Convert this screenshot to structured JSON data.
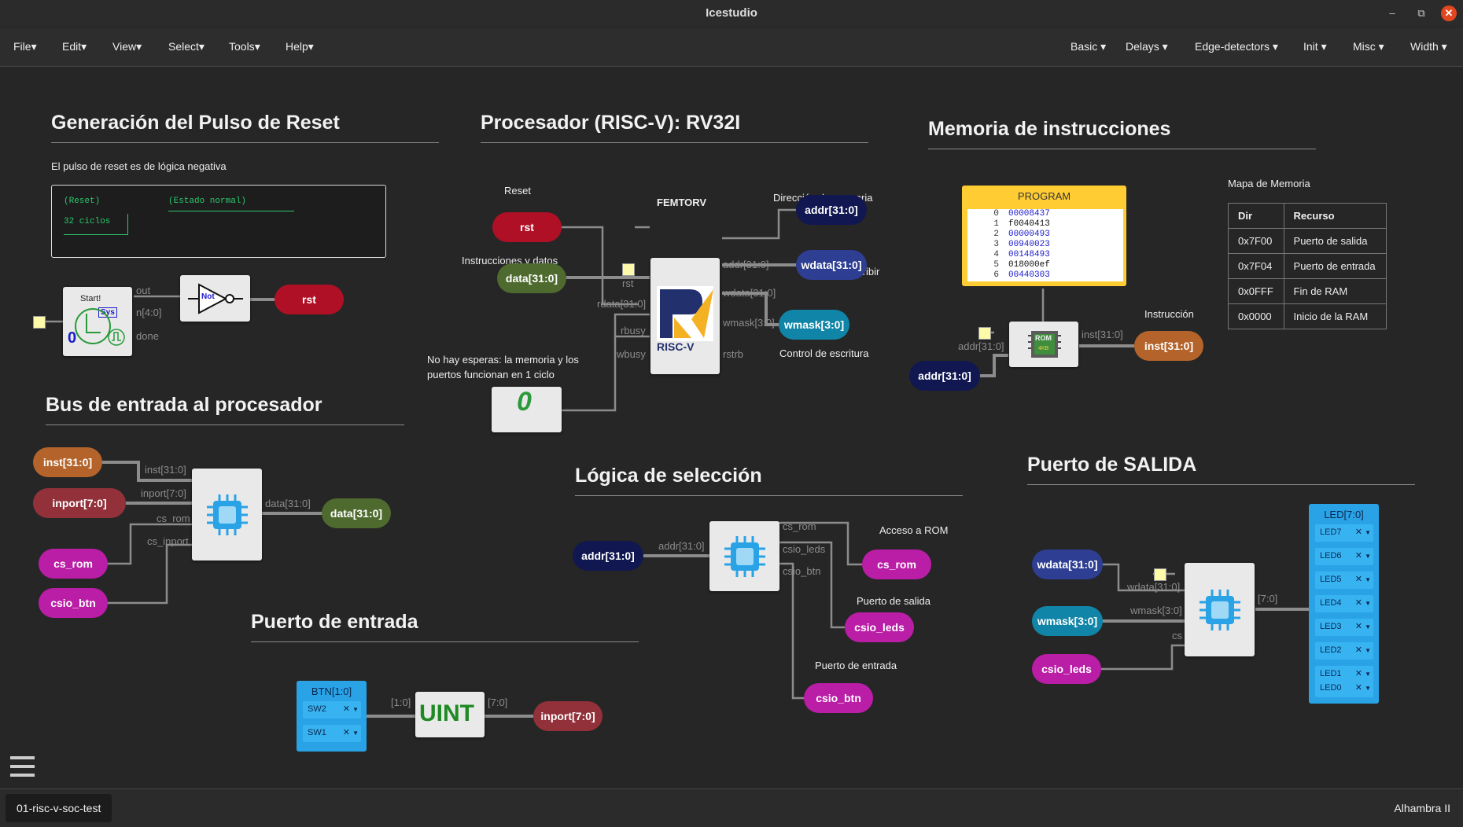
{
  "window": {
    "title": "Icestudio",
    "minimize": "–",
    "restore": "⧉",
    "close": "✕"
  },
  "menu_left": [
    "File",
    "Edit",
    "View",
    "Select",
    "Tools",
    "Help"
  ],
  "menu_right": [
    "Basic",
    "Delays",
    "Edge-detectors",
    "Init",
    "Misc",
    "Width"
  ],
  "sections": {
    "reset": "Generación del Pulso de Reset",
    "cpu": "Procesador (RISC-V): RV32I",
    "imem": "Memoria de instrucciones",
    "inbus": "Bus de entrada al procesador",
    "select": "Lógica de selección",
    "outport": "Puerto de SALIDA",
    "inport": "Puerto de entrada"
  },
  "notes": {
    "reset_desc": "El pulso de reset es de lógica negativa",
    "cpu_reset": "Reset",
    "cpu_name": "FEMTORV",
    "instr_data": "Instrucciones y datos",
    "no_wait": "No hay esperas: la memoria y los puertos funcionan en 1 ciclo",
    "mem_addr": "Dirección de memoria",
    "data_write": "Datos a escribir",
    "write_ctrl": "Control de escritura",
    "instruction": "Instrucción",
    "mem_map": "Mapa de Memoria",
    "rom_access": "Acceso a ROM",
    "out_port": "Puerto de salida",
    "in_port": "Puerto de entrada"
  },
  "terminal": {
    "reset": "(Reset)",
    "normal": "(Estado normal)",
    "cycles": "32 ciclos"
  },
  "start_block": {
    "title": "Start!",
    "sys": "Sys",
    "zero": "0",
    "out": "out",
    "n": "n[4:0]",
    "done": "done"
  },
  "not_gate": "Not",
  "risc_v": {
    "letter": "RISC-V"
  },
  "pills": {
    "rst_cpu": "rst",
    "rst_not": "rst",
    "addr_out": "addr[31:0]",
    "wdata_out": "wdata[31:0]",
    "wmask_out": "wmask[3:0]",
    "data_in": "data[31:0]",
    "addr_rom": "addr[31:0]",
    "inst_rom": "inst[31:0]",
    "inst_bus": "inst[31:0]",
    "inport_bus": "inport[7:0]",
    "csrom_bus": "cs_rom",
    "csiobtn_bus": "csio_btn",
    "data_bus": "data[31:0]",
    "addr_sel": "addr[31:0]",
    "csrom_sel": "cs_rom",
    "csioleds_sel": "csio_leds",
    "csiobtn_sel": "csio_btn",
    "wdata_port": "wdata[31:0]",
    "wmask_port": "wmask[3:0]",
    "csioleds_port": "csio_leds",
    "inport_in": "inport[7:0]"
  },
  "port_labels": {
    "cpu_addr": "addr[31:0]",
    "cpu_rst": "rst",
    "cpu_rdata": "rdata[31:0]",
    "cpu_wdata": "wdata[31:0]",
    "cpu_rbusy": "rbusy",
    "cpu_wmask": "wmask[3:0]",
    "cpu_wbusy": "wbusy",
    "cpu_rstrb": "rstrb",
    "rom_addr": "addr[31:0]",
    "rom_inst": "inst[31:0]",
    "bus_inst": "inst[31:0]",
    "bus_inport": "inport[7:0]",
    "bus_csrom": "cs_rom",
    "bus_csinport": "cs_inport",
    "bus_data": "data[31:0]",
    "sel_addr": "addr[31:0]",
    "sel_csrom": "cs_rom",
    "sel_csleds": "csio_leds",
    "sel_csbtn": "csio_btn",
    "out_wdata": "wdata[31:0]",
    "out_wmask": "wmask[3:0]",
    "out_cs": "cs",
    "out_7": "[7:0]",
    "in_10": "[1:0]",
    "in_70": "[7:0]"
  },
  "program": {
    "title": "PROGRAM",
    "rows": [
      {
        "i": "0",
        "v": "00008437"
      },
      {
        "i": "1",
        "v": "f0040413"
      },
      {
        "i": "2",
        "v": "00000493"
      },
      {
        "i": "3",
        "v": "00940023"
      },
      {
        "i": "4",
        "v": "00148493"
      },
      {
        "i": "5",
        "v": "018000ef"
      },
      {
        "i": "6",
        "v": "00440303"
      }
    ]
  },
  "rom_chip": {
    "top": "ROM",
    "bottom": "4KB"
  },
  "memory_map": {
    "headers": [
      "Dir",
      "Recurso"
    ],
    "rows": [
      [
        "0x7F00",
        "Puerto de salida"
      ],
      [
        "0x7F04",
        "Puerto de entrada"
      ],
      [
        "0x0FFF",
        "Fin de RAM"
      ],
      [
        "0x0000",
        "Inicio de la RAM"
      ]
    ]
  },
  "leds": {
    "title": "LED[7:0]",
    "items": [
      "LED7",
      "LED6",
      "LED5",
      "LED4",
      "LED3",
      "LED2",
      "LED1",
      "LED0"
    ]
  },
  "buttons": {
    "title": "BTN[1:0]",
    "items": [
      "SW2",
      "SW1"
    ]
  },
  "uint": "UINT",
  "zero_block": "0",
  "status": {
    "tab": "01-risc-v-soc-test",
    "board": "Alhambra II"
  },
  "colors": {
    "background": "#262626",
    "wire": "#8c8c8c",
    "accent_chip": "#2aa3e6",
    "program": "#ffcc33"
  }
}
